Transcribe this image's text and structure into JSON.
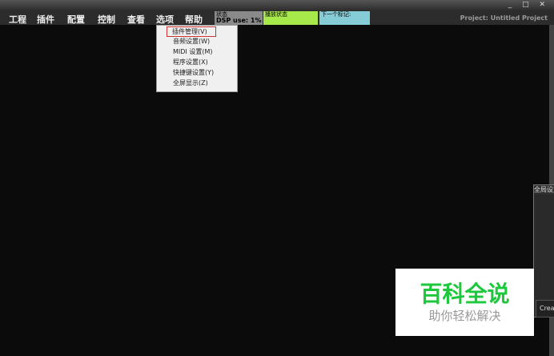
{
  "window": {
    "controls": "_ □ ✕"
  },
  "menu": [
    "工程",
    "插件",
    "配置",
    "控制",
    "查看",
    "选项",
    "帮助"
  ],
  "status": {
    "box1_title": "状态",
    "box1_value": "DSP use: 1%",
    "box2": "播放状态",
    "box3": "下一个标记:",
    "box2_color": "#a7e84a",
    "box3_color": "#86ccd6"
  },
  "project": "Project: Untitled Project",
  "dropdown": [
    "插件管理(V)",
    "音频设置(W)",
    "MIDI 设置(M)",
    "程序设置(X)",
    "快捷键设置(Y)",
    "全屏显示(Z)"
  ],
  "panel": {
    "title": "全局设置",
    "button": "Create"
  },
  "watermark": {
    "title": "百科全说",
    "subtitle": "助你轻松解决"
  }
}
